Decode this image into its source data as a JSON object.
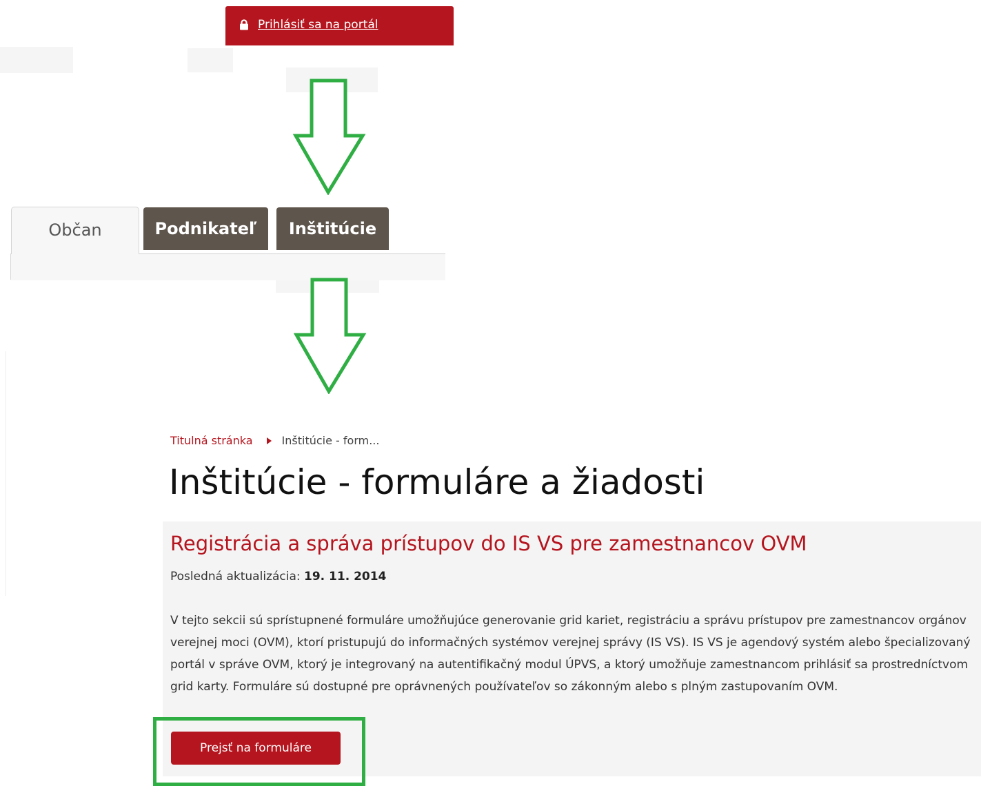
{
  "login": {
    "link_label": "Prihlásiť sa na portál",
    "icon": "lock-icon"
  },
  "tabs": [
    {
      "label": "Občan",
      "active": true
    },
    {
      "label": "Podnikateľ",
      "active": false
    },
    {
      "label": "Inštitúcie",
      "active": false
    }
  ],
  "breadcrumb": {
    "home": "Titulná stránka",
    "current": "Inštitúcie - form..."
  },
  "page": {
    "title": "Inštitúcie - formuláre a žiadosti"
  },
  "section": {
    "heading": "Registrácia a správa prístupov do IS VS pre zamestnancov OVM",
    "updated_label": "Posledná aktualizácia:",
    "updated_date": "19. 11. 2014",
    "description": "V tejto sekcii sú sprístupnené formuláre umožňujúce generovanie grid kariet, registráciu a správu prístupov pre zamestnancov orgánov verejnej moci (OVM), ktorí pristupujú do informačných systémov verejnej správy (IS VS). IS VS  je agendový systém alebo špecializovaný portál v správe OVM, ktorý je integrovaný na autentifikačný modul ÚPVS, a ktorý umožňuje zamestnancom prihlásiť sa prostredníctvom grid karty. Formuláre sú dostupné pre oprávnených používateľov so zákonným alebo s plným zastupovaním OVM.",
    "button_label": "Prejsť na formuláre"
  },
  "colors": {
    "brand_red": "#b5151e",
    "tab_dark": "#5e554c",
    "annotation_green": "#2fae44",
    "section_bg": "#f4f4f4"
  }
}
